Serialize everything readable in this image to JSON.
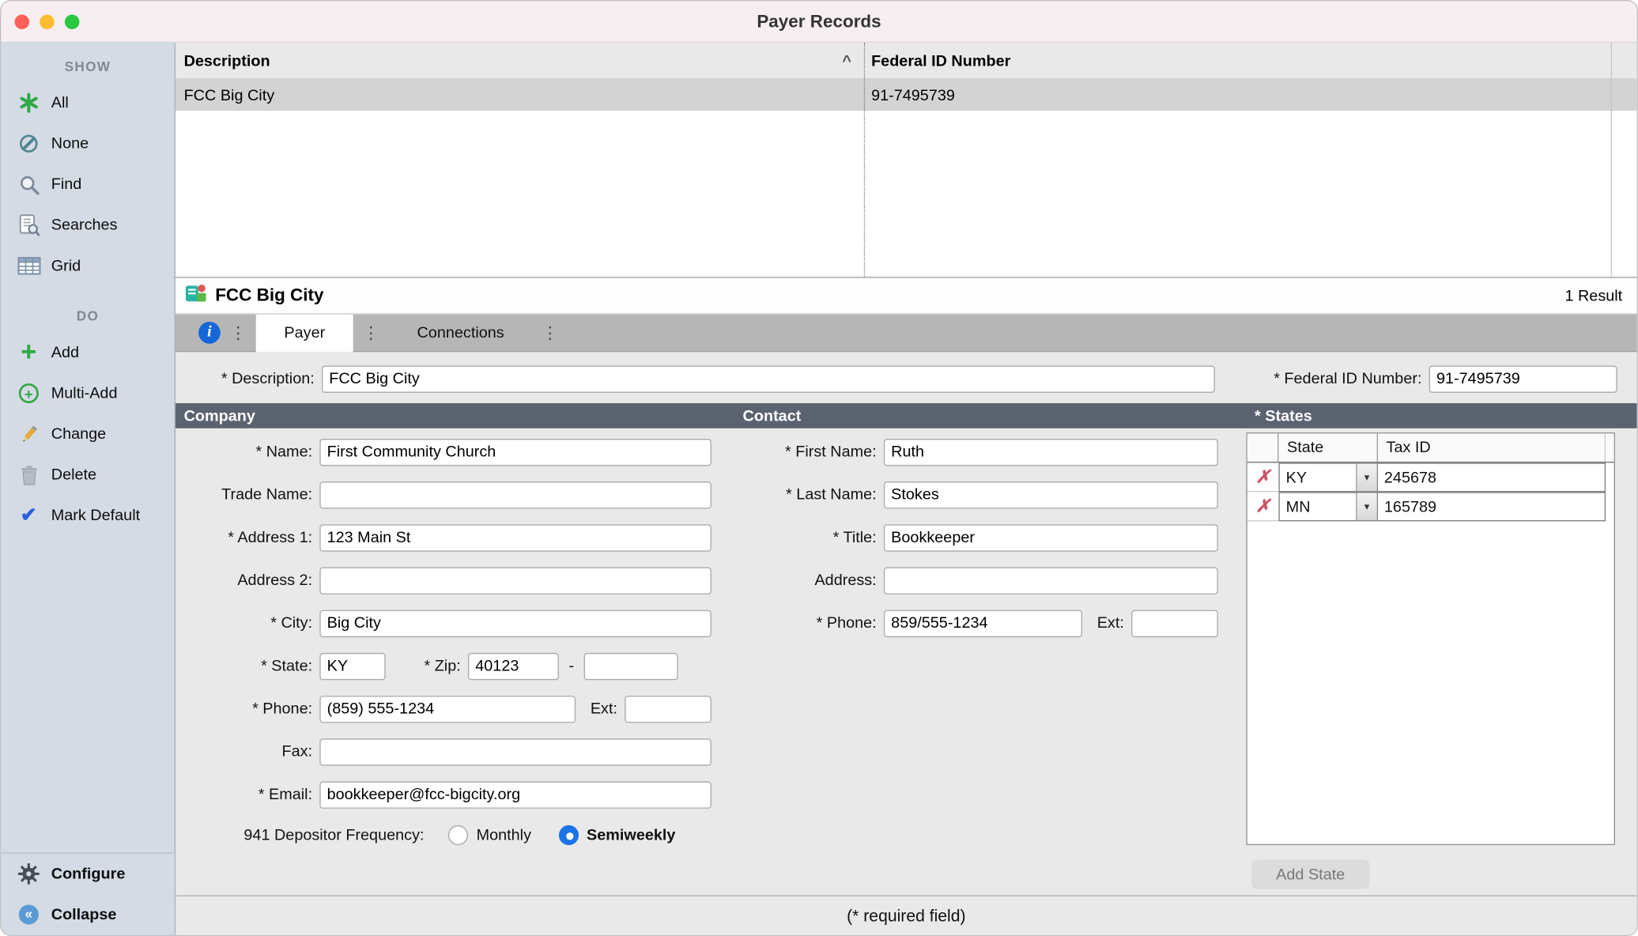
{
  "window": {
    "title": "Payer Records"
  },
  "sidebar": {
    "glyphs": {
      "plus": "+",
      "check": "✔",
      "collapse": "«"
    },
    "sections": [
      {
        "header": "SHOW",
        "items": [
          {
            "label": "All",
            "icon": "asterisk-icon"
          },
          {
            "label": "None",
            "icon": "none-circle-icon"
          },
          {
            "label": "Find",
            "icon": "magnifier-icon"
          },
          {
            "label": "Searches",
            "icon": "saved-searches-icon"
          },
          {
            "label": "Grid",
            "icon": "grid-icon"
          }
        ]
      },
      {
        "header": "DO",
        "items": [
          {
            "label": "Add",
            "icon": "plus-icon"
          },
          {
            "label": "Multi-Add",
            "icon": "circle-plus-icon"
          },
          {
            "label": "Change",
            "icon": "pencil-icon"
          },
          {
            "label": "Delete",
            "icon": "trash-icon"
          },
          {
            "label": "Mark Default",
            "icon": "checkmark-icon"
          }
        ]
      }
    ],
    "footer": [
      {
        "label": "Configure",
        "icon": "gear-icon"
      },
      {
        "label": "Collapse",
        "icon": "collapse-circle-icon"
      }
    ]
  },
  "records_list": {
    "columns": [
      {
        "label": "Description"
      },
      {
        "label": "Federal ID Number"
      }
    ],
    "sort_indicator": "^",
    "rows": [
      {
        "description": "FCC Big City",
        "federal_id": "91-7495739",
        "selected": true
      }
    ]
  },
  "record_bar": {
    "title": "FCC Big City",
    "results": "1 Result"
  },
  "tab_bar": {
    "info_glyph": "i",
    "ellipsis_glyph": "⋮",
    "tabs": [
      {
        "label": "Payer",
        "active": true
      },
      {
        "label": "Connections",
        "active": false
      }
    ]
  },
  "form": {
    "description": {
      "label": "* Description:",
      "value": "FCC Big City"
    },
    "federal_id": {
      "label": "* Federal ID Number:",
      "value": "91-7495739"
    },
    "company": {
      "header": "Company",
      "name": {
        "label": "* Name:",
        "value": "First Community Church"
      },
      "trade_name": {
        "label": "Trade Name:",
        "value": ""
      },
      "address1": {
        "label": "* Address 1:",
        "value": "123 Main St"
      },
      "address2": {
        "label": "Address 2:",
        "value": ""
      },
      "city": {
        "label": "* City:",
        "value": "Big City"
      },
      "state": {
        "label": "* State:",
        "value": "KY"
      },
      "zip": {
        "label": "* Zip:",
        "value": "40123",
        "separator": "-",
        "plus4": ""
      },
      "phone": {
        "label": "* Phone:",
        "value": "(859) 555-1234"
      },
      "ext": {
        "label": "Ext:",
        "value": ""
      },
      "fax": {
        "label": "Fax:",
        "value": ""
      },
      "email": {
        "label": "* Email:",
        "value": "bookkeeper@fcc-bigcity.org"
      },
      "depositor": {
        "label": "941 Depositor Frequency:",
        "options": [
          {
            "label": "Monthly",
            "selected": false
          },
          {
            "label": "Semiweekly",
            "selected": true
          }
        ]
      }
    },
    "contact": {
      "header": "Contact",
      "first_name": {
        "label": "* First Name:",
        "value": "Ruth"
      },
      "last_name": {
        "label": "* Last Name:",
        "value": "Stokes"
      },
      "title": {
        "label": "* Title:",
        "value": "Bookkeeper"
      },
      "address": {
        "label": "Address:",
        "value": ""
      },
      "phone": {
        "label": "* Phone:",
        "value": "859/555-1234"
      },
      "ext": {
        "label": "Ext:",
        "value": ""
      }
    },
    "states": {
      "header": "* States",
      "columns": [
        {
          "label": "State"
        },
        {
          "label": "Tax ID"
        }
      ],
      "rows": [
        {
          "state": "KY",
          "tax_id": "245678"
        },
        {
          "state": "MN",
          "tax_id": "165789"
        }
      ],
      "delete_glyph": "✗",
      "dropdown_glyph": "▾",
      "add_button": "Add State"
    }
  },
  "statusbar": {
    "note": "(* required field)"
  },
  "colors": {
    "titlebar_bg": "#f6eef1",
    "sidebar_bg": "#d4dbe5",
    "section_header_bg": "#5b6270",
    "selected_row_bg": "#d3d3d3",
    "tab_bar_bg": "#b6b6b6",
    "accent_blue": "#1566d8",
    "radio_selected": "#1a73e8",
    "delete_x_red": "#c9556b",
    "traffic_red": "#ff5f57",
    "traffic_yellow": "#febc2e",
    "traffic_green": "#28c840"
  }
}
